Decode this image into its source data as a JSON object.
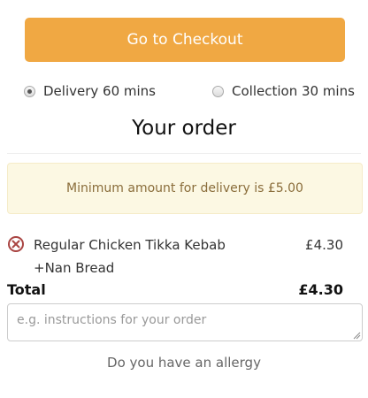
{
  "checkout": {
    "label": "Go to Checkout",
    "color": "#f0a843"
  },
  "order_type": {
    "options": [
      {
        "label": "Delivery 60 mins",
        "selected": true
      },
      {
        "label": "Collection 30 mins",
        "selected": false
      }
    ]
  },
  "order": {
    "title": "Your order",
    "minimum_notice": "Minimum amount for delivery is £5.00",
    "items": [
      {
        "name": "Regular Chicken Tikka Kebab",
        "addon": "+Nan Bread",
        "price": "£4.30",
        "remove_icon": "remove-circle-x-icon"
      }
    ],
    "total_label": "Total",
    "total_value": "£4.30",
    "instructions_placeholder": "e.g. instructions for your order",
    "allergy_link": "Do you have an allergy"
  }
}
